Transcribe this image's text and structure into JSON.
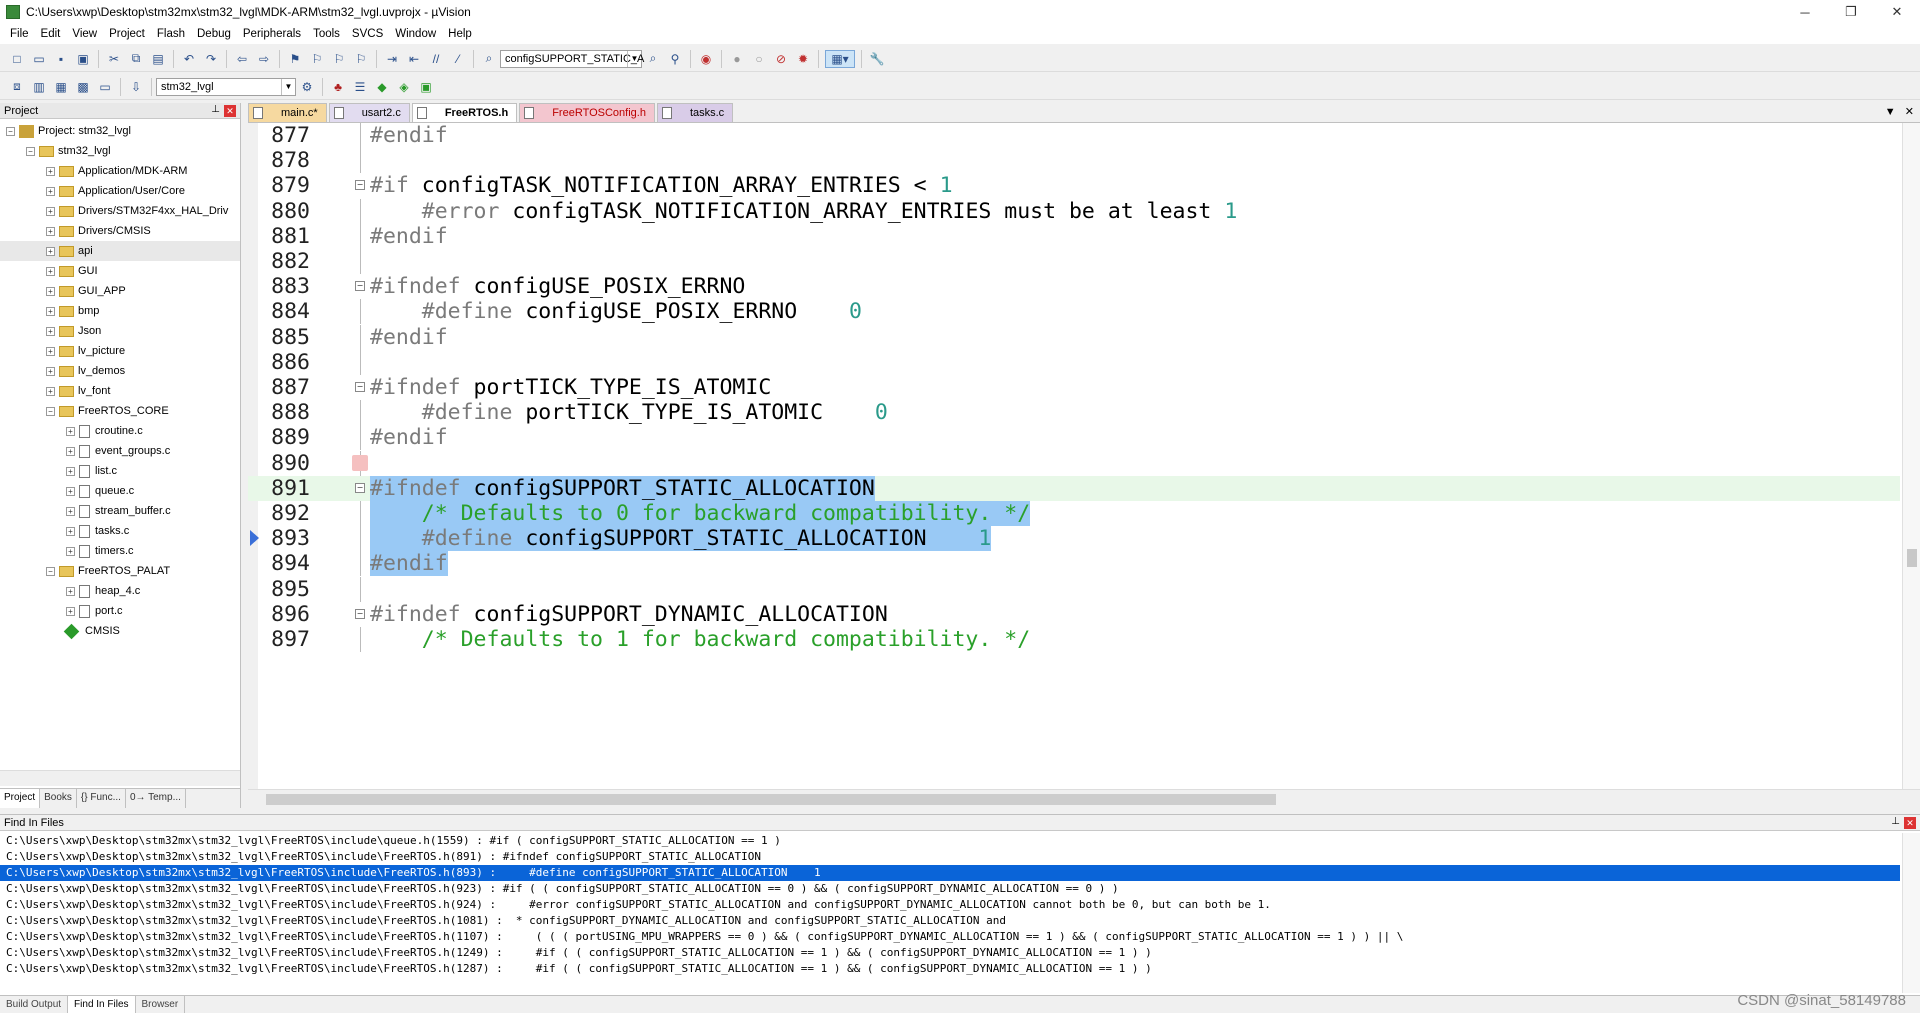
{
  "window": {
    "title": "C:\\Users\\xwp\\Desktop\\stm32mx\\stm32_lvgl\\MDK-ARM\\stm32_lvgl.uvprojx - µVision"
  },
  "menu": [
    "File",
    "Edit",
    "View",
    "Project",
    "Flash",
    "Debug",
    "Peripherals",
    "Tools",
    "SVCS",
    "Window",
    "Help"
  ],
  "toolbar": {
    "find_combo": "configSUPPORT_STATIC_A",
    "target_combo": "stm32_lvgl"
  },
  "project_panel": {
    "title": "Project",
    "root": "Project: stm32_lvgl",
    "target": "stm32_lvgl",
    "groups": [
      "Application/MDK-ARM",
      "Application/User/Core",
      "Drivers/STM32F4xx_HAL_Driv",
      "Drivers/CMSIS",
      "api",
      "GUI",
      "GUI_APP",
      "bmp",
      "Json",
      "lv_picture",
      "lv_demos",
      "lv_font",
      "FreeRTOS_CORE"
    ],
    "freertos_core_files": [
      "croutine.c",
      "event_groups.c",
      "list.c",
      "queue.c",
      "stream_buffer.c",
      "tasks.c",
      "timers.c"
    ],
    "palat_group": "FreeRTOS_PALAT",
    "palat_files": [
      "heap_4.c",
      "port.c"
    ],
    "cmsis": "CMSIS",
    "tabs": [
      "Project",
      "Books",
      "{} Func...",
      "0→ Temp..."
    ]
  },
  "editor": {
    "tabs": [
      "main.c*",
      "usart2.c",
      "FreeRTOS.h",
      "FreeRTOSConfig.h",
      "tasks.c"
    ],
    "lines": [
      {
        "n": "877",
        "parts": [
          [
            "kw",
            "#endif"
          ]
        ]
      },
      {
        "n": "878",
        "parts": []
      },
      {
        "n": "879",
        "parts": [
          [
            "kw",
            "#if"
          ],
          [
            "",
            " configTASK_NOTIFICATION_ARRAY_ENTRIES < "
          ],
          [
            "num",
            "1"
          ]
        ]
      },
      {
        "n": "880",
        "parts": [
          [
            "kw",
            "    #error"
          ],
          [
            "",
            " configTASK_NOTIFICATION_ARRAY_ENTRIES must be at least "
          ],
          [
            "num",
            "1"
          ]
        ]
      },
      {
        "n": "881",
        "parts": [
          [
            "kw",
            "#endif"
          ]
        ]
      },
      {
        "n": "882",
        "parts": []
      },
      {
        "n": "883",
        "parts": [
          [
            "kw",
            "#ifndef"
          ],
          [
            "",
            " configUSE_POSIX_ERRNO"
          ]
        ]
      },
      {
        "n": "884",
        "parts": [
          [
            "kw",
            "    #define"
          ],
          [
            "",
            " configUSE_POSIX_ERRNO    "
          ],
          [
            "num",
            "0"
          ]
        ]
      },
      {
        "n": "885",
        "parts": [
          [
            "kw",
            "#endif"
          ]
        ]
      },
      {
        "n": "886",
        "parts": []
      },
      {
        "n": "887",
        "parts": [
          [
            "kw",
            "#ifndef"
          ],
          [
            "",
            " portTICK_TYPE_IS_ATOMIC"
          ]
        ]
      },
      {
        "n": "888",
        "parts": [
          [
            "kw",
            "    #define"
          ],
          [
            "",
            " portTICK_TYPE_IS_ATOMIC    "
          ],
          [
            "num",
            "0"
          ]
        ]
      },
      {
        "n": "889",
        "parts": [
          [
            "kw",
            "#endif"
          ]
        ]
      },
      {
        "n": "890",
        "parts": []
      },
      {
        "n": "891",
        "parts": [
          [
            "kw",
            "#ifndef"
          ],
          [
            "",
            " configSUPPORT_STATIC_ALLOCATION"
          ]
        ]
      },
      {
        "n": "892",
        "parts": [
          [
            "",
            "    "
          ],
          [
            "cm",
            "/* Defaults to 0 for backward compatibility. */"
          ]
        ]
      },
      {
        "n": "893",
        "parts": [
          [
            "kw",
            "    #define"
          ],
          [
            "",
            " configSUPPORT_STATIC_ALLOCATION    "
          ],
          [
            "num",
            "1"
          ]
        ]
      },
      {
        "n": "894",
        "parts": [
          [
            "kw",
            "#endif"
          ]
        ]
      },
      {
        "n": "895",
        "parts": []
      },
      {
        "n": "896",
        "parts": [
          [
            "kw",
            "#ifndef"
          ],
          [
            "",
            " configSUPPORT_DYNAMIC_ALLOCATION"
          ]
        ]
      },
      {
        "n": "897",
        "parts": [
          [
            "",
            "    "
          ],
          [
            "cm",
            "/* Defaults to 1 for backward compatibility. */"
          ]
        ]
      }
    ]
  },
  "find_in_files": {
    "title": "Find In Files",
    "rows": [
      "C:\\Users\\xwp\\Desktop\\stm32mx\\stm32_lvgl\\FreeRTOS\\include\\queue.h(1559) : #if ( configSUPPORT_STATIC_ALLOCATION == 1 )",
      "C:\\Users\\xwp\\Desktop\\stm32mx\\stm32_lvgl\\FreeRTOS\\include\\FreeRTOS.h(891) : #ifndef configSUPPORT_STATIC_ALLOCATION",
      "C:\\Users\\xwp\\Desktop\\stm32mx\\stm32_lvgl\\FreeRTOS\\include\\FreeRTOS.h(893) :     #define configSUPPORT_STATIC_ALLOCATION    1",
      "C:\\Users\\xwp\\Desktop\\stm32mx\\stm32_lvgl\\FreeRTOS\\include\\FreeRTOS.h(923) : #if ( ( configSUPPORT_STATIC_ALLOCATION == 0 ) && ( configSUPPORT_DYNAMIC_ALLOCATION == 0 ) )",
      "C:\\Users\\xwp\\Desktop\\stm32mx\\stm32_lvgl\\FreeRTOS\\include\\FreeRTOS.h(924) :     #error configSUPPORT_STATIC_ALLOCATION and configSUPPORT_DYNAMIC_ALLOCATION cannot both be 0, but can both be 1.",
      "C:\\Users\\xwp\\Desktop\\stm32mx\\stm32_lvgl\\FreeRTOS\\include\\FreeRTOS.h(1081) :  * configSUPPORT_DYNAMIC_ALLOCATION and configSUPPORT_STATIC_ALLOCATION and",
      "C:\\Users\\xwp\\Desktop\\stm32mx\\stm32_lvgl\\FreeRTOS\\include\\FreeRTOS.h(1107) :     ( ( ( portUSING_MPU_WRAPPERS == 0 ) && ( configSUPPORT_DYNAMIC_ALLOCATION == 1 ) && ( configSUPPORT_STATIC_ALLOCATION == 1 ) ) || \\",
      "C:\\Users\\xwp\\Desktop\\stm32mx\\stm32_lvgl\\FreeRTOS\\include\\FreeRTOS.h(1249) :     #if ( ( configSUPPORT_STATIC_ALLOCATION == 1 ) && ( configSUPPORT_DYNAMIC_ALLOCATION == 1 ) )",
      "C:\\Users\\xwp\\Desktop\\stm32mx\\stm32_lvgl\\FreeRTOS\\include\\FreeRTOS.h(1287) :     #if ( ( configSUPPORT_STATIC_ALLOCATION == 1 ) && ( configSUPPORT_DYNAMIC_ALLOCATION == 1 ) )"
    ],
    "tabs": [
      "Build Output",
      "Find In Files",
      "Browser"
    ]
  },
  "watermark": "CSDN @sinat_58149788"
}
